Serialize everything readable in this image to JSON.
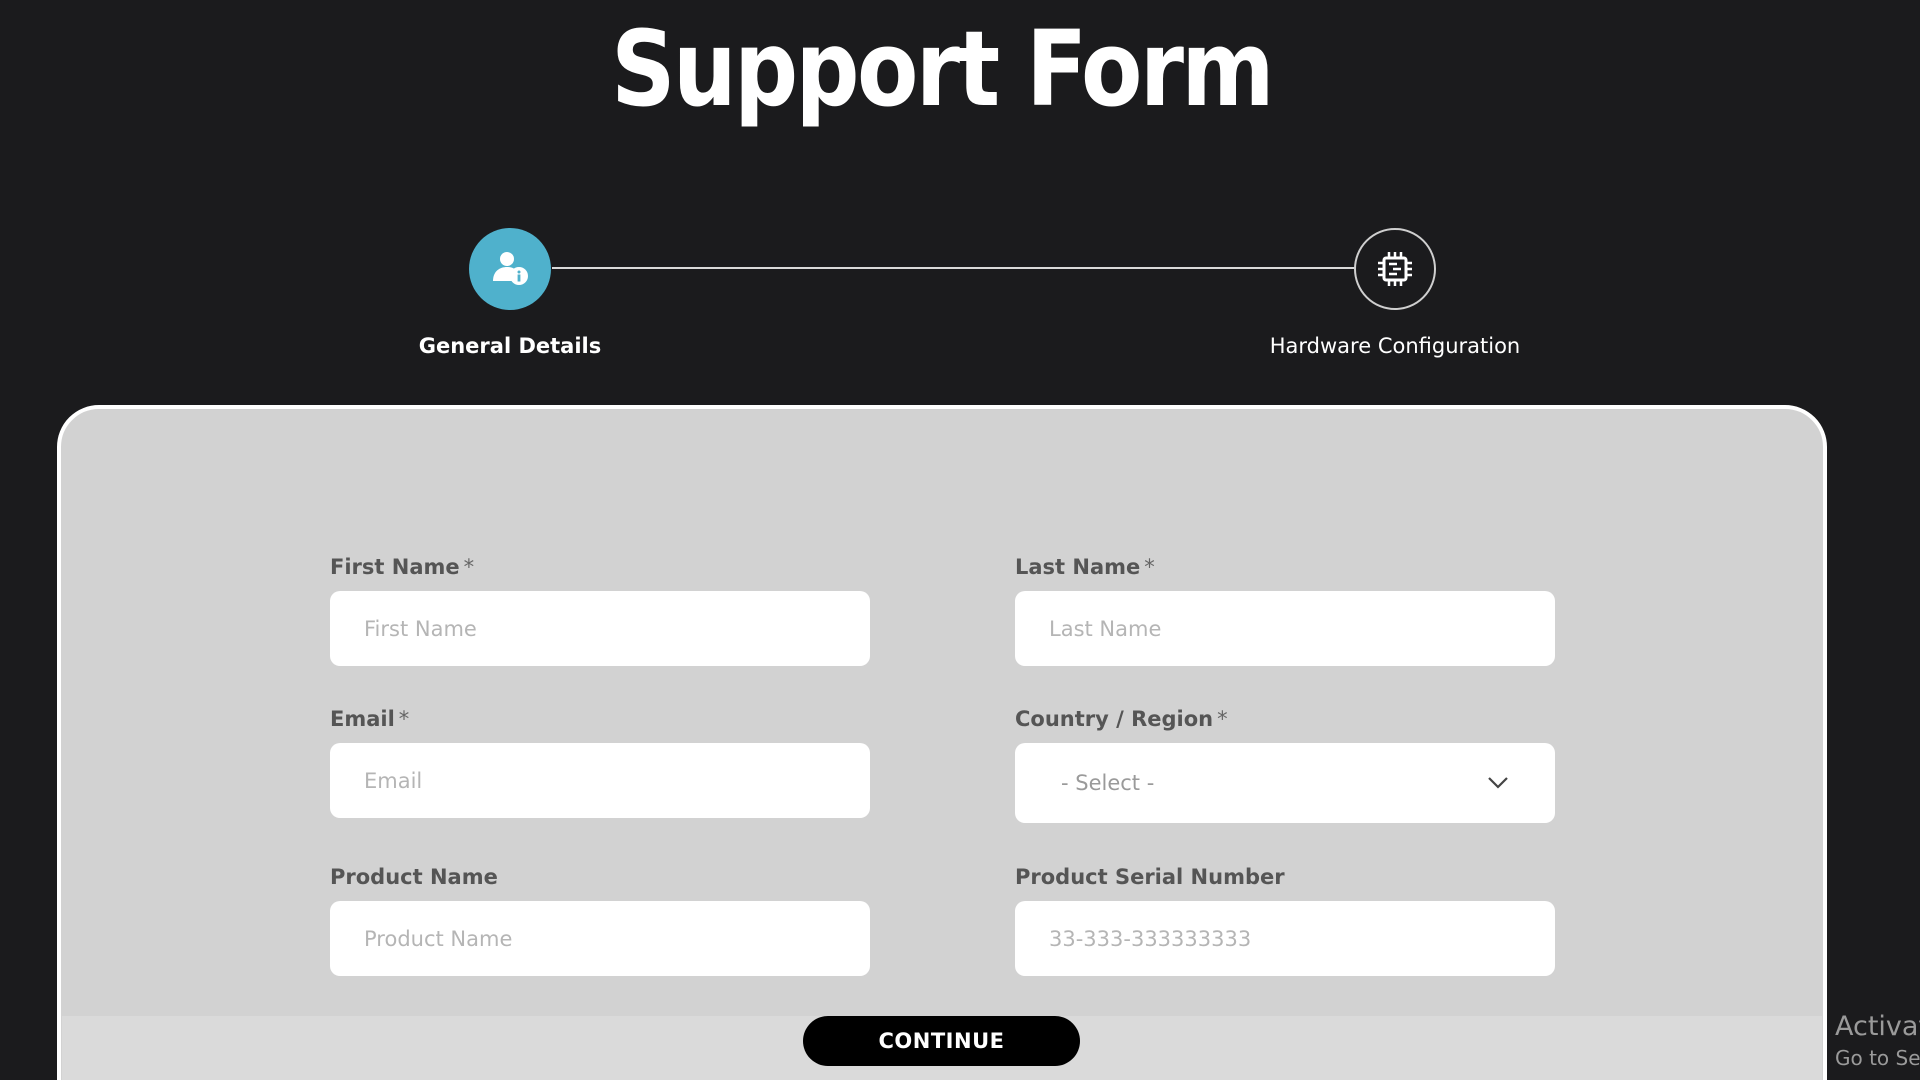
{
  "header": {
    "title": "Support Form"
  },
  "stepper": {
    "steps": [
      {
        "label": "General Details",
        "icon": "user-info-icon",
        "active": true
      },
      {
        "label": "Hardware Configuration",
        "icon": "chip-icon",
        "active": false
      }
    ],
    "active_color": "#4fb1cc"
  },
  "form": {
    "first_name": {
      "label": "First Name",
      "required_mark": "*",
      "placeholder": "First Name"
    },
    "last_name": {
      "label": "Last Name",
      "required_mark": "*",
      "placeholder": "Last Name"
    },
    "email": {
      "label": "Email",
      "required_mark": "*",
      "placeholder": "Email"
    },
    "country": {
      "label": "Country / Region",
      "required_mark": "*",
      "selected": "- Select -"
    },
    "product_name": {
      "label": "Product Name",
      "placeholder": "Product Name"
    },
    "serial_number": {
      "label": "Product Serial Number",
      "placeholder": "33-333-333333333"
    }
  },
  "actions": {
    "continue_label": "CONTINUE"
  },
  "watermark": {
    "line1": "Activat",
    "line2": "Go to Set"
  }
}
